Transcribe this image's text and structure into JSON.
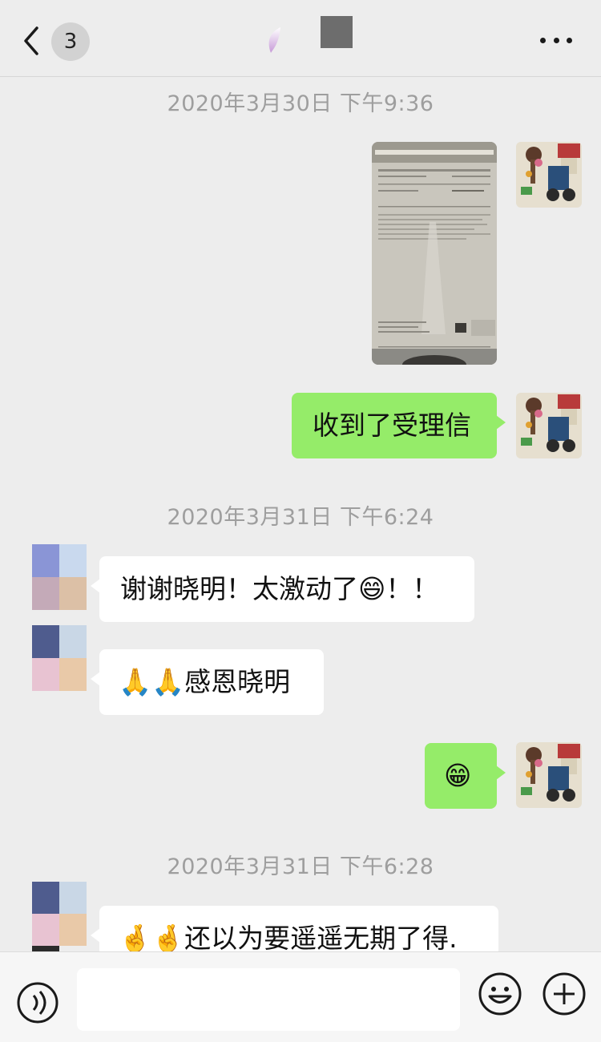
{
  "header": {
    "back_icon": "chevron-left-icon",
    "unread_count": "3",
    "more_icon": "ellipsis-icon"
  },
  "messages": {
    "ts1": "2020年3月30日 下午9:36",
    "msg_text_1": "收到了受理信",
    "ts2": "2020年3月31日 下午6:24",
    "msg_text_2": "谢谢晓明！太激动了😄！！",
    "msg_text_3": "🙏🙏感恩晓明",
    "msg_text_4": "😁",
    "ts3": "2020年3月31日 下午6:28",
    "msg_text_5": "🤞🤞还以为要遥遥无期了得."
  },
  "input_bar": {
    "voice_icon": "voice-icon",
    "text_value": "",
    "emoji_icon": "smiley-icon",
    "plus_icon": "plus-icon"
  },
  "colors": {
    "background": "#ededed",
    "self_bubble": "#95ec69",
    "other_bubble": "#ffffff",
    "timestamp": "#9e9e9e"
  }
}
